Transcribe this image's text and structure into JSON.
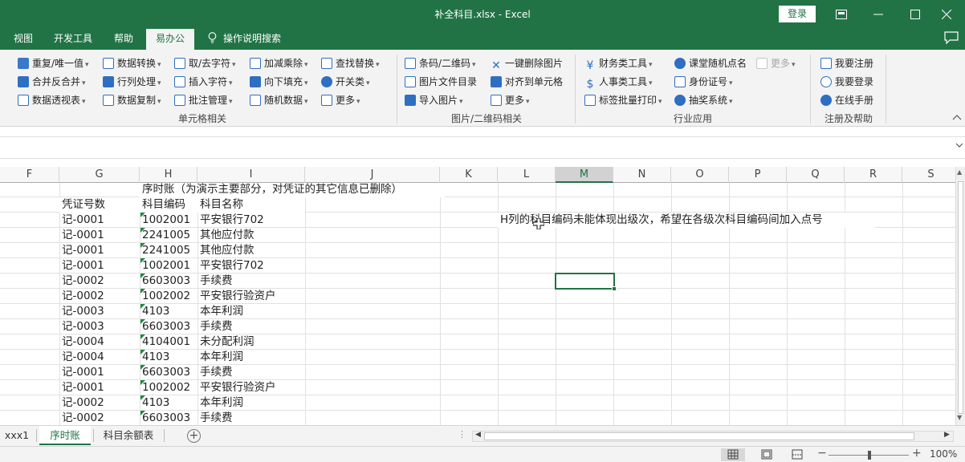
{
  "window": {
    "title": "补全科目.xlsx  -  Excel",
    "login_label": "登录",
    "controls": [
      "ribbon-display-icon",
      "minimize-icon",
      "maximize-icon",
      "close-icon"
    ]
  },
  "menu": {
    "items": [
      "视图",
      "开发工具",
      "帮助",
      "易办公"
    ],
    "active": "易办公",
    "search_label": "操作说明搜索"
  },
  "ribbon": {
    "groups": [
      {
        "label": "单元格相关",
        "items": [
          {
            "label": "重复/唯一值",
            "icon": "duplicate-icon",
            "dropdown": true
          },
          {
            "label": "合并反合并",
            "icon": "merge-icon",
            "dropdown": true
          },
          {
            "label": "数据透视表",
            "icon": "pivot-icon",
            "dropdown": true
          },
          {
            "label": "数据转换",
            "icon": "convert-icon",
            "dropdown": true
          },
          {
            "label": "行列处理",
            "icon": "rows-icon",
            "dropdown": true
          },
          {
            "label": "数据复制",
            "icon": "copy-icon",
            "dropdown": true
          },
          {
            "label": "取/去字符",
            "icon": "chars-icon",
            "dropdown": true
          },
          {
            "label": "插入字符",
            "icon": "insert-icon",
            "dropdown": true
          },
          {
            "label": "批注管理",
            "icon": "comment-manage-icon",
            "dropdown": true
          },
          {
            "label": "加减乘除",
            "icon": "calc-icon",
            "dropdown": true
          },
          {
            "label": "向下填充",
            "icon": "fill-down-icon",
            "dropdown": true
          },
          {
            "label": "随机数据",
            "icon": "random-icon",
            "dropdown": true
          },
          {
            "label": "查找替换",
            "icon": "replace-icon",
            "dropdown": true
          },
          {
            "label": "开关类",
            "icon": "toggle-icon",
            "dropdown": true
          },
          {
            "label": "更多",
            "icon": "more-icon",
            "dropdown": true
          }
        ]
      },
      {
        "label": "图片/二维码相关",
        "items": [
          {
            "label": "条码/二维码",
            "icon": "qrcode-icon",
            "dropdown": true
          },
          {
            "label": "图片文件目录",
            "icon": "image-folder-icon",
            "dropdown": false
          },
          {
            "label": "导入图片",
            "icon": "import-image-icon",
            "dropdown": true
          },
          {
            "label": "一键删除图片",
            "icon": "delete-icon",
            "dropdown": false
          },
          {
            "label": "对齐到单元格",
            "icon": "align-icon",
            "dropdown": false
          },
          {
            "label": "更多",
            "icon": "more-icon",
            "dropdown": true
          }
        ]
      },
      {
        "label": "行业应用",
        "items": [
          {
            "label": "财务类工具",
            "icon": "yen-icon",
            "dropdown": true
          },
          {
            "label": "人事类工具",
            "icon": "dollar-icon",
            "dropdown": true
          },
          {
            "label": "标签批量打印",
            "icon": "print-label-icon",
            "dropdown": true
          },
          {
            "label": "课堂随机点名",
            "icon": "rollcall-icon",
            "dropdown": false
          },
          {
            "label": "身份证号",
            "icon": "id-card-icon",
            "dropdown": true
          },
          {
            "label": "抽奖系统",
            "icon": "lottery-icon",
            "dropdown": true
          },
          {
            "label": "更多",
            "icon": "more-icon",
            "dropdown": true,
            "disabled": true
          }
        ]
      },
      {
        "label": "注册及帮助",
        "items": [
          {
            "label": "我要注册",
            "icon": "register-icon",
            "dropdown": false
          },
          {
            "label": "我要登录",
            "icon": "user-login-icon",
            "dropdown": false
          },
          {
            "label": "在线手册",
            "icon": "manual-icon",
            "dropdown": false
          }
        ]
      }
    ]
  },
  "sheet": {
    "columns": [
      "F",
      "G",
      "H",
      "I",
      "J",
      "K",
      "L",
      "M",
      "N",
      "O",
      "P",
      "Q",
      "R",
      "S"
    ],
    "selected_column": "M",
    "header_note": "序时账（为演示主要部分，对凭证的其它信息已删除）",
    "headers": {
      "voucher": "凭证号数",
      "code": "科目编码",
      "name": "科目名称"
    },
    "note": "H列的科目编码未能体现出级次，希望在各级次科目编码间加入点号",
    "rows": [
      {
        "voucher": "",
        "code": "1002001",
        "name": "平安银行702"
      },
      {
        "voucher": "记-0001",
        "code": "2241005",
        "name": "其他应付款"
      },
      {
        "voucher": "记-0001",
        "code": "2241005",
        "name": "其他应付款"
      },
      {
        "voucher": "记-0001",
        "code": "1002001",
        "name": "平安银行702"
      },
      {
        "voucher": "记-0002",
        "code": "6603003",
        "name": "手续费"
      },
      {
        "voucher": "记-0002",
        "code": "1002002",
        "name": "平安银行验资户"
      },
      {
        "voucher": "记-0003",
        "code": "4103",
        "name": "本年利润"
      },
      {
        "voucher": "记-0003",
        "code": "6603003",
        "name": "手续费"
      },
      {
        "voucher": "记-0004",
        "code": "4104001",
        "name": "未分配利润"
      },
      {
        "voucher": "记-0004",
        "code": "4103",
        "name": "本年利润"
      },
      {
        "voucher": "记-0001",
        "code": "6603003",
        "name": "手续费"
      },
      {
        "voucher": "记-0001",
        "code": "1002002",
        "name": "平安银行验资户"
      },
      {
        "voucher": "记-0002",
        "code": "4103",
        "name": "本年利润"
      },
      {
        "voucher": "记-0002",
        "code": "6603003",
        "name": "手续费"
      }
    ],
    "first_voucher": "记-0001"
  },
  "tabs": {
    "items": [
      "xxx1",
      "序时账",
      "科目余额表"
    ],
    "active": "序时账"
  },
  "status": {
    "zoom": "100%",
    "zoom_minus": "−",
    "zoom_plus": "+"
  }
}
